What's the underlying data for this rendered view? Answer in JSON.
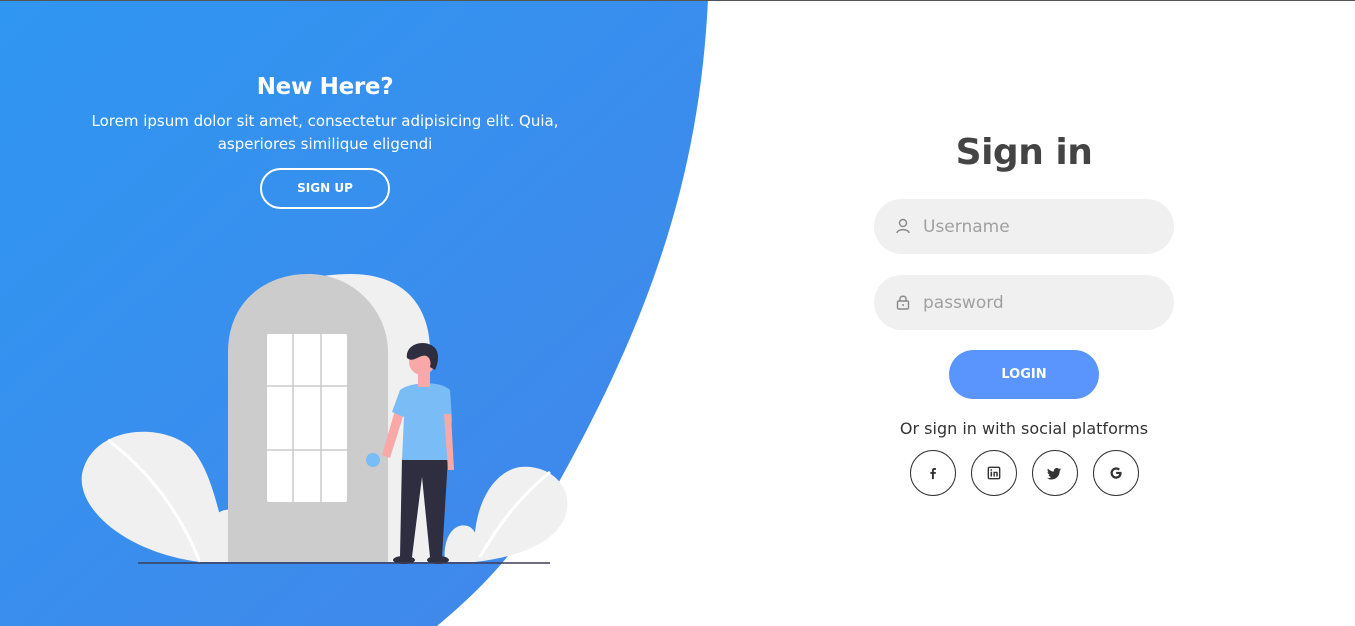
{
  "panel": {
    "title": "New Here?",
    "text": "Lorem ipsum dolor sit amet, consectetur adipisicing elit. Quia, asperiores similique eligendi",
    "button_label": "SIGN UP"
  },
  "signin": {
    "title": "Sign in",
    "username_placeholder": "Username",
    "password_placeholder": "password",
    "login_label": "LOGIN",
    "social_text": "Or sign in with social platforms",
    "social_icons": [
      "facebook-icon",
      "linkedin-icon",
      "twitter-icon",
      "google-icon"
    ]
  },
  "colors": {
    "panel_gradient_start": "#2f96f1",
    "panel_gradient_end": "#4087eb",
    "login_button": "#5995fd",
    "input_background": "#f0f0f0",
    "title_text": "#444444"
  }
}
